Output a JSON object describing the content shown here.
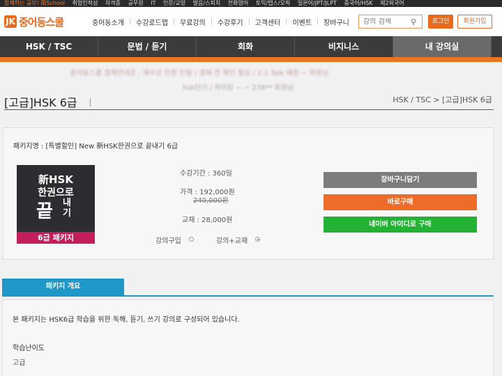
{
  "topbar": {
    "items": [
      "함께하는 공부! 雨School",
      "취업인적성",
      "자격증",
      "공무원",
      "IT",
      "인문/교양",
      "발음/스피치",
      "전화영어",
      "토익/텝스/오픽",
      "일본어/JPT/JLPT",
      "중국어/HSK",
      "제2외국어"
    ]
  },
  "header": {
    "logo_mark": "JK",
    "logo_text": "중어동스쿨",
    "nav": [
      "중어동소개",
      "수강로드맵",
      "무료강의",
      "수강후기",
      "고객센터",
      "이벤트",
      "장바구니"
    ],
    "search": {
      "placeholder": "강의 검색"
    },
    "login_label": "로그인",
    "join_label": "회원가입"
  },
  "mainnav": {
    "tabs": [
      "HSK / TSC",
      "문법 / 듣기",
      "회화",
      "비지니스",
      "내 강의실"
    ],
    "active": "내 강의실"
  },
  "notice": {
    "line1": "중어동스쿨 결제안내문 : 재수강 인정 안됨 / 결제 전 확인 필요 / 1:1 Talk 예정 ~ 회원님",
    "line2": "hsk단기 / 하이킹 ~ ~ 238** 회원님"
  },
  "page": {
    "title": "[고급]HSK 6급",
    "breadcrumb": "HSK / TSC > [고급]HSK 6급"
  },
  "package": {
    "name": "패키지명 : [특별할인] New 新HSK한권으로 끝내기 6급",
    "book": {
      "line1": "新HSK",
      "line2": "한권으로",
      "big": "끝",
      "small": "내\n기",
      "badge": "6급 패키지"
    },
    "period": "수강기간 : 360일",
    "price": "가격 : 192,000원",
    "original_price": "240,000원",
    "textbook": "교재 : 28,000원",
    "options": [
      {
        "label": "강의구입",
        "checked": false
      },
      {
        "label": "강의+교재",
        "checked": true
      }
    ],
    "buttons": {
      "cart": "장바구니담기",
      "buy": "바로구매",
      "naver": "네이버 아이디로 구매"
    }
  },
  "overview": {
    "tab_label": "패키지 개요",
    "description": "본 패키지는 HSK6급 학습을 위한 독해, 듣기, 쓰기 강의로 구성되어 있습니다.",
    "level_heading": "학습난이도",
    "level_value": "고급"
  },
  "colors": {
    "accent_orange": "#e8761f",
    "nav_dark": "#3b3b3b",
    "overview_blue": "#1f97c7",
    "buy_orange": "#ed6c27",
    "naver_green": "#23b233",
    "cart_gray": "#7c7c7c",
    "book_badge": "#c21e5b"
  }
}
